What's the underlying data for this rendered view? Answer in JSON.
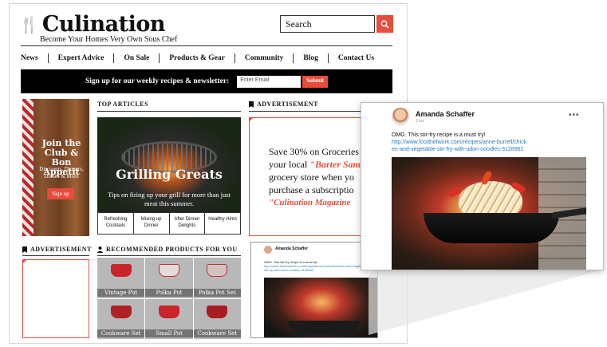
{
  "brand": {
    "name": "Culination",
    "tagline": "Become Your Homes Very Own Sous Chef",
    "accent": "#e74c3c"
  },
  "search": {
    "placeholder": "Search"
  },
  "nav": {
    "items": [
      "News",
      "Expert Advice",
      "On Sale",
      "Products & Gear",
      "Community",
      "Blog",
      "Contact Us"
    ]
  },
  "newsletter": {
    "text": "Sign up for our weekly recipes & newsletter:",
    "email_placeholder": "Enter Email",
    "submit": "Submit"
  },
  "club": {
    "title": "Join the Club & Bon Appetit",
    "subtitle": "Discounts, Dinners, Dishes & More",
    "button": "Sign up"
  },
  "top_articles": {
    "heading": "TOP ARTICLES",
    "feature_title": "Grilling Greats",
    "feature_desc": "Tips on firing up your grill for more than just meat this summer.",
    "sub_items": [
      "Refreshing Cocktails",
      "Mixing up Dinner",
      "After Dinner Delights",
      "Healthy Hints"
    ]
  },
  "ad_right": {
    "heading": "ADVERTISEMENT",
    "line1": "Save 30% on Groceries",
    "line2_a": "your local ",
    "line2_b": "\"Barter Sam",
    "line3": "grocery store when yo",
    "line4": "purchase a subscriptio",
    "line5": "\"Culination Magazine"
  },
  "ad_left": {
    "heading": "ADVERTISEMENT"
  },
  "products": {
    "heading": "RECOMMENDED PRODUCTS FOR YOU",
    "items": [
      {
        "label": "Vintage Pot",
        "color": "#c8242b"
      },
      {
        "label": "Polka Pot",
        "color": "#e5d9d9"
      },
      {
        "label": "Polka Pot Set",
        "color": "#d4c2c2"
      },
      {
        "label": "Cookware Set",
        "color": "#b02025"
      },
      {
        "label": "Small Pot",
        "color": "#c8242b"
      },
      {
        "label": "Cookware Set",
        "color": "#a81d21"
      }
    ]
  },
  "post": {
    "author": "Amanda Schaffer",
    "time": "3 hrs",
    "text": "OMG. This stir-fry recipe is a must try!",
    "link": "http://www.foodnetwork.com/recipes/anne-burrell/chicken-and-vegetable-stir-fry-with-udon-noodles-3128962",
    "link_short_1": "http://www.foodnetwork.com/recipes/anne-burrell/chick",
    "link_short_2": "en-and-vegetable-stir-fry-with-udon-noodles-3128962",
    "menu": "•••"
  }
}
